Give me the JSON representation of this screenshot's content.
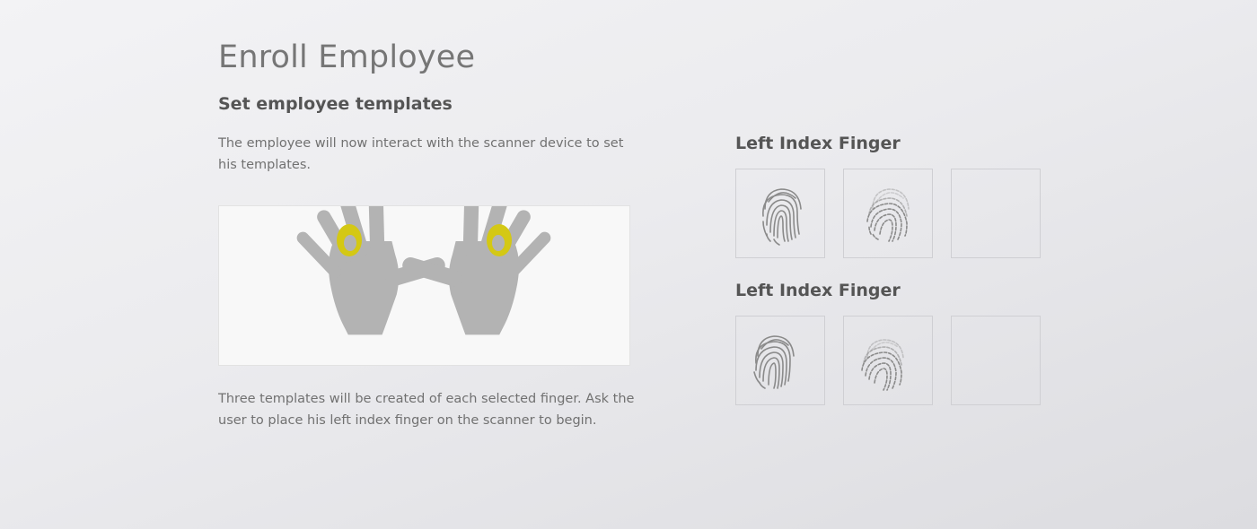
{
  "page": {
    "title": "Enroll Employee",
    "section_title": "Set employee templates",
    "intro": "The employee will now interact with the scanner device to set his templates.",
    "footer": "Three templates will be created of each selected finger.  Ask the user to place his left index finger on the scanner to begin."
  },
  "hands": {
    "left_hand_icon": "left-hand-icon",
    "right_hand_icon": "right-hand-icon",
    "highlight_color": "#d4c814",
    "hand_color": "#b3b3b3"
  },
  "finger_groups": [
    {
      "label": "Left Index Finger",
      "slots": [
        {
          "state": "captured",
          "icon": "fingerprint-icon"
        },
        {
          "state": "capturing",
          "icon": "fingerprint-icon"
        },
        {
          "state": "empty"
        }
      ]
    },
    {
      "label": "Left Index Finger",
      "slots": [
        {
          "state": "captured",
          "icon": "fingerprint-icon"
        },
        {
          "state": "capturing",
          "icon": "fingerprint-icon"
        },
        {
          "state": "empty"
        }
      ]
    }
  ]
}
